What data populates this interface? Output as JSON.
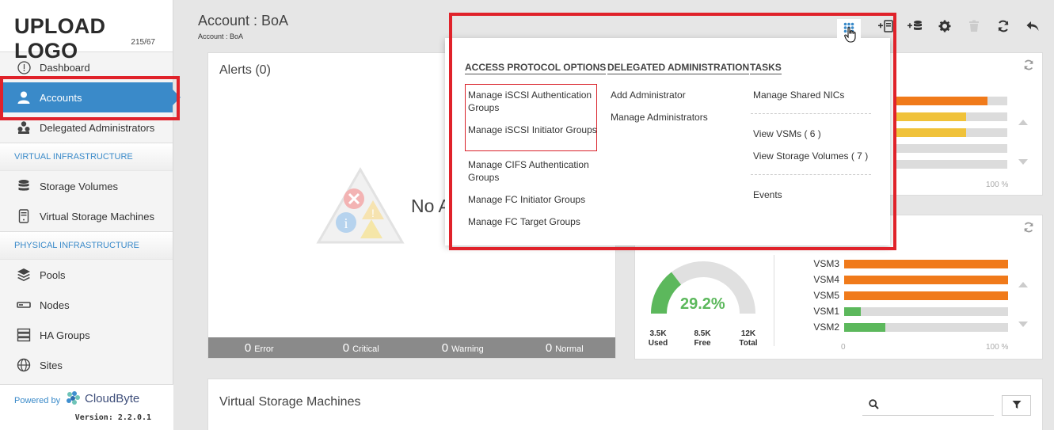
{
  "logo": {
    "text": "UPLOAD LOGO",
    "sub": "215/67"
  },
  "sidebar": {
    "items": [
      {
        "label": "Dashboard",
        "icon": "dashboard-icon"
      },
      {
        "label": "Accounts",
        "icon": "user-icon",
        "active": true
      },
      {
        "label": "Delegated Administrators",
        "icon": "admins-icon"
      }
    ],
    "sections": [
      {
        "title": "VIRTUAL INFRASTRUCTURE",
        "items": [
          {
            "label": "Storage Volumes",
            "icon": "database-icon"
          },
          {
            "label": "Virtual Storage Machines",
            "icon": "vsm-icon"
          }
        ]
      },
      {
        "title": "PHYSICAL INFRASTRUCTURE",
        "items": [
          {
            "label": "Pools",
            "icon": "layers-icon"
          },
          {
            "label": "Nodes",
            "icon": "node-icon"
          },
          {
            "label": "HA Groups",
            "icon": "server-stack-icon"
          },
          {
            "label": "Sites",
            "icon": "globe-icon"
          }
        ]
      }
    ],
    "powered_by": "Powered by",
    "brand": "CloudByte",
    "version": "Version: 2.2.0.1"
  },
  "header": {
    "title": "Account : BoA",
    "breadcrumb": "Account : BoA"
  },
  "alerts": {
    "title": "Alerts (0)",
    "empty": "No A",
    "footer": [
      {
        "num": "0",
        "label": "Error"
      },
      {
        "num": "0",
        "label": "Critical"
      },
      {
        "num": "0",
        "label": "Warning"
      },
      {
        "num": "0",
        "label": "Normal"
      }
    ]
  },
  "panel1": {
    "bars": [
      {
        "value": 0.82,
        "color": "#f07a1a"
      },
      {
        "value": 0.63,
        "color": "#f0c23a"
      },
      {
        "value": 0.63,
        "color": "#f0c23a"
      },
      {
        "value": 0.0,
        "color": "#dcdcdc"
      },
      {
        "value": 0.0,
        "color": "#dcdcdc"
      }
    ],
    "axis_max": "100 %"
  },
  "panel2": {
    "gauge": {
      "value": "29.2%",
      "fraction": 0.292
    },
    "stats": [
      {
        "value": "3.5K",
        "label": "Used"
      },
      {
        "value": "8.5K",
        "label": "Free"
      },
      {
        "value": "12K",
        "label": "Total"
      }
    ],
    "vsms": [
      {
        "name": "VSM3",
        "value": 1.0,
        "color": "#f07a1a"
      },
      {
        "name": "VSM4",
        "value": 1.0,
        "color": "#f07a1a"
      },
      {
        "name": "VSM5",
        "value": 1.0,
        "color": "#f07a1a"
      },
      {
        "name": "VSM1",
        "value": 0.1,
        "color": "#5cb85c"
      },
      {
        "name": "VSM2",
        "value": 0.25,
        "color": "#5cb85c"
      }
    ],
    "axis_min": "0",
    "axis_max": "100 %"
  },
  "vsm_panel": {
    "title": "Virtual Storage Machines"
  },
  "menu": {
    "access": {
      "title": "ACCESS PROTOCOL OPTIONS",
      "items": [
        "Manage iSCSI Authentication Groups",
        "Manage iSCSI Initiator Groups",
        "Manage CIFS Authentication Groups",
        "Manage FC Initiator Groups",
        "Manage FC Target Groups"
      ]
    },
    "delegated": {
      "title": "DELEGATED ADMINISTRATION",
      "items": [
        "Add Administrator",
        "Manage Administrators"
      ]
    },
    "tasks": {
      "title": "TASKS",
      "items": [
        "Manage Shared NICs",
        "View VSMs ( 6 )",
        "View Storage Volumes ( 7 )",
        "Events"
      ]
    }
  }
}
